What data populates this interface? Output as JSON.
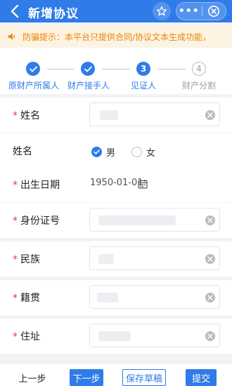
{
  "header": {
    "title": "新增协议",
    "more_label": "•••"
  },
  "notice": {
    "text": "防骗提示：本平台只提供合同/协议文本生成功能，"
  },
  "steps": [
    {
      "label": "原财产所属人",
      "state": "done"
    },
    {
      "label": "财产接手人",
      "state": "done"
    },
    {
      "label": "见证人",
      "number": "3",
      "state": "active"
    },
    {
      "label": "财产分割",
      "number": "4",
      "state": "todo"
    }
  ],
  "form": {
    "name": {
      "label": "姓名",
      "required": true
    },
    "gender": {
      "label": "姓名",
      "options": [
        "男",
        "女"
      ],
      "selected": "男"
    },
    "birth": {
      "label": "出生日期",
      "required": true,
      "value": "1950-01-01"
    },
    "id_number": {
      "label": "身份证号",
      "required": true
    },
    "ethnicity": {
      "label": "民族",
      "required": true
    },
    "native_place": {
      "label": "籍贯",
      "required": true
    },
    "address": {
      "label": "住址",
      "required": true
    },
    "required_mark": "*"
  },
  "bottom": {
    "prev_label": "上一步",
    "next_label": "下一步",
    "save_label": "保存草稿",
    "submit_label": "提交"
  },
  "colors": {
    "primary": "#2f7ce8",
    "notice_text": "#e8860c",
    "notice_bg": "#fdf3e1",
    "required": "#e53935"
  },
  "icons": [
    "back-arrow-icon",
    "star-icon",
    "more-icon",
    "close-circle-icon",
    "speaker-icon",
    "check-icon",
    "clear-icon",
    "calendar-icon"
  ]
}
